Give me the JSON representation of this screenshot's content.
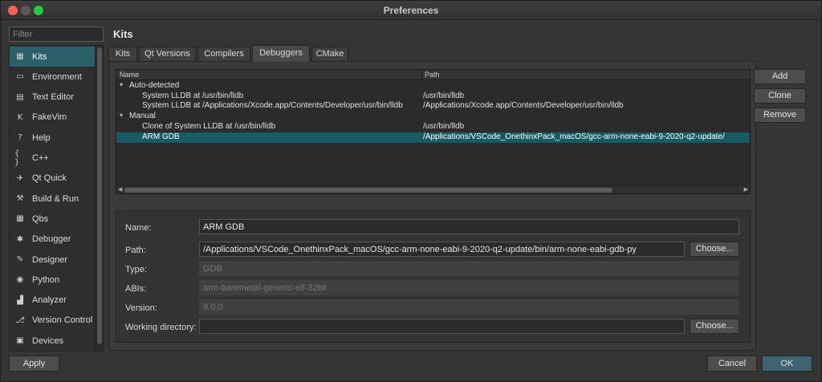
{
  "window": {
    "title": "Preferences"
  },
  "filter": {
    "placeholder": "Filter"
  },
  "sidebar": {
    "items": [
      {
        "label": "Kits",
        "icon": "kits-icon",
        "glyph": "▦",
        "active": true
      },
      {
        "label": "Environment",
        "icon": "monitor-icon",
        "glyph": "▭"
      },
      {
        "label": "Text Editor",
        "icon": "text-editor-icon",
        "glyph": "▤"
      },
      {
        "label": "FakeVim",
        "icon": "fakevim-icon",
        "glyph": "K"
      },
      {
        "label": "Help",
        "icon": "help-icon",
        "glyph": "?"
      },
      {
        "label": "C++",
        "icon": "braces-icon",
        "glyph": "{ }"
      },
      {
        "label": "Qt Quick",
        "icon": "qt-quick-icon",
        "glyph": "✈"
      },
      {
        "label": "Build & Run",
        "icon": "hammer-icon",
        "glyph": "⚒"
      },
      {
        "label": "Qbs",
        "icon": "grid-icon",
        "glyph": "▦"
      },
      {
        "label": "Debugger",
        "icon": "bug-icon",
        "glyph": "✱"
      },
      {
        "label": "Designer",
        "icon": "pencil-icon",
        "glyph": "✎"
      },
      {
        "label": "Python",
        "icon": "python-icon",
        "glyph": "◉"
      },
      {
        "label": "Analyzer",
        "icon": "analyzer-icon",
        "glyph": "▟"
      },
      {
        "label": "Version Control",
        "icon": "version-control-icon",
        "glyph": "⎇"
      },
      {
        "label": "Devices",
        "icon": "devices-icon",
        "glyph": "▣"
      }
    ]
  },
  "page": {
    "heading": "Kits"
  },
  "tabs": [
    {
      "label": "Kits"
    },
    {
      "label": "Qt Versions"
    },
    {
      "label": "Compilers"
    },
    {
      "label": "Debuggers",
      "active": true
    },
    {
      "label": "CMake"
    }
  ],
  "tree": {
    "columns": {
      "name": "Name",
      "path": "Path"
    },
    "groups": [
      {
        "label": "Auto-detected",
        "rows": [
          {
            "name": "System LLDB at /usr/bin/lldb",
            "path": "/usr/bin/lldb"
          },
          {
            "name": "System LLDB at /Applications/Xcode.app/Contents/Developer/usr/bin/lldb",
            "path": "/Applications/Xcode.app/Contents/Developer/usr/bin/lldb"
          }
        ]
      },
      {
        "label": "Manual",
        "rows": [
          {
            "name": "Clone of System LLDB at /usr/bin/lldb",
            "path": "/usr/bin/lldb"
          },
          {
            "name": "ARM GDB",
            "path": "/Applications/VSCode_OnethinxPack_macOS/gcc-arm-none-eabi-9-2020-q2-update/",
            "selected": true
          }
        ]
      }
    ]
  },
  "actions": {
    "add": "Add",
    "clone": "Clone",
    "remove": "Remove"
  },
  "details": {
    "name_label": "Name:",
    "name_value": "ARM GDB",
    "path_label": "Path:",
    "path_value": "/Applications/VSCode_OnethinxPack_macOS/gcc-arm-none-eabi-9-2020-q2-update/bin/arm-none-eabi-gdb-py",
    "type_label": "Type:",
    "type_value": "GDB",
    "abis_label": "ABIs:",
    "abis_value": "arm-baremetal-generic-elf-32bit",
    "version_label": "Version:",
    "version_value": "9.0.0",
    "workdir_label": "Working directory:",
    "workdir_value": "",
    "choose_label": "Choose..."
  },
  "footer": {
    "apply": "Apply",
    "cancel": "Cancel",
    "ok": "OK"
  },
  "colors": {
    "accent": "#2b5f6a",
    "selection": "#175a63",
    "background": "#353535"
  }
}
